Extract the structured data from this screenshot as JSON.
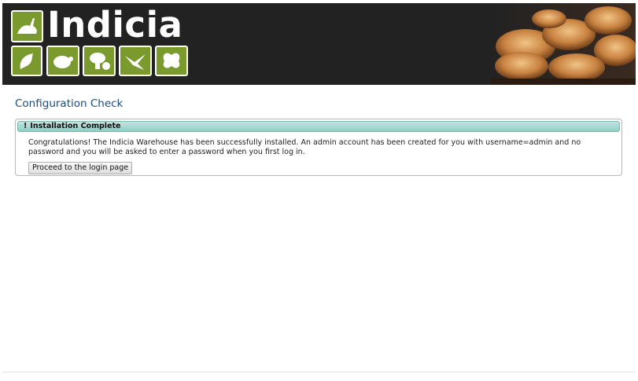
{
  "header": {
    "logo_text": "Indicia",
    "logo_icons": [
      "hare-icon",
      "oak-leaf-icon",
      "beetle-icon",
      "mushroom-icon",
      "swallow-icon",
      "butterfly-icon"
    ]
  },
  "page": {
    "title": "Configuration Check"
  },
  "panel": {
    "header_bang": "!",
    "header": "Installation Complete",
    "message": "Congratulations! The Indicia Warehouse has been successfully installed. An admin account has been created for you with username=admin and no password and you will be asked to enter a password when you first log in.",
    "button_label": "Proceed to the login page"
  },
  "colors": {
    "banner": "#222222",
    "tile": "#7a9a2e",
    "title": "#1f4c7a",
    "panel_header": "#a8dbd2"
  }
}
